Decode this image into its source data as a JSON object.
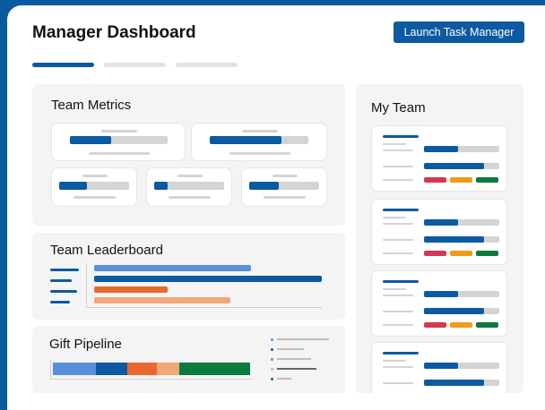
{
  "header": {
    "title": "Manager Dashboard",
    "launch_label": "Launch Task Manager"
  },
  "colors": {
    "primary": "#0b5aa2",
    "light_blue": "#5b8fd9",
    "orange": "#e8692f",
    "peach": "#f0a878",
    "green": "#0a7a3e",
    "red": "#d13a50",
    "amber": "#f29a1a",
    "placeholder": "#d4d4d4"
  },
  "tabs": [
    {
      "active": true
    },
    {
      "active": false
    },
    {
      "active": false
    }
  ],
  "team_metrics": {
    "title": "Team Metrics",
    "progress": [
      0.42,
      0.73,
      0.4,
      0.18,
      0.42
    ]
  },
  "team_leaderboard": {
    "title": "Team Leaderboard",
    "bars": [
      {
        "value": 0.69,
        "color": "light_blue"
      },
      {
        "value": 1.0,
        "color": "primary"
      },
      {
        "value": 0.32,
        "color": "orange"
      },
      {
        "value": 0.6,
        "color": "peach"
      }
    ]
  },
  "gift_pipeline": {
    "title": "Gift Pipeline",
    "segments": [
      {
        "share": 0.21,
        "color": "light_blue"
      },
      {
        "share": 0.16,
        "color": "primary"
      },
      {
        "share": 0.15,
        "color": "orange"
      },
      {
        "share": 0.11,
        "color": "peach"
      },
      {
        "share": 0.37,
        "color": "green"
      }
    ],
    "legend": [
      "light_blue",
      "primary",
      "orange",
      "peach",
      "green"
    ]
  },
  "my_team": {
    "title": "My Team",
    "members": [
      {
        "progress": [
          0.45,
          0.8
        ]
      },
      {
        "progress": [
          0.45,
          0.8
        ]
      },
      {
        "progress": [
          0.45,
          0.8
        ]
      },
      {
        "progress": [
          0.45,
          0.8
        ]
      }
    ]
  }
}
